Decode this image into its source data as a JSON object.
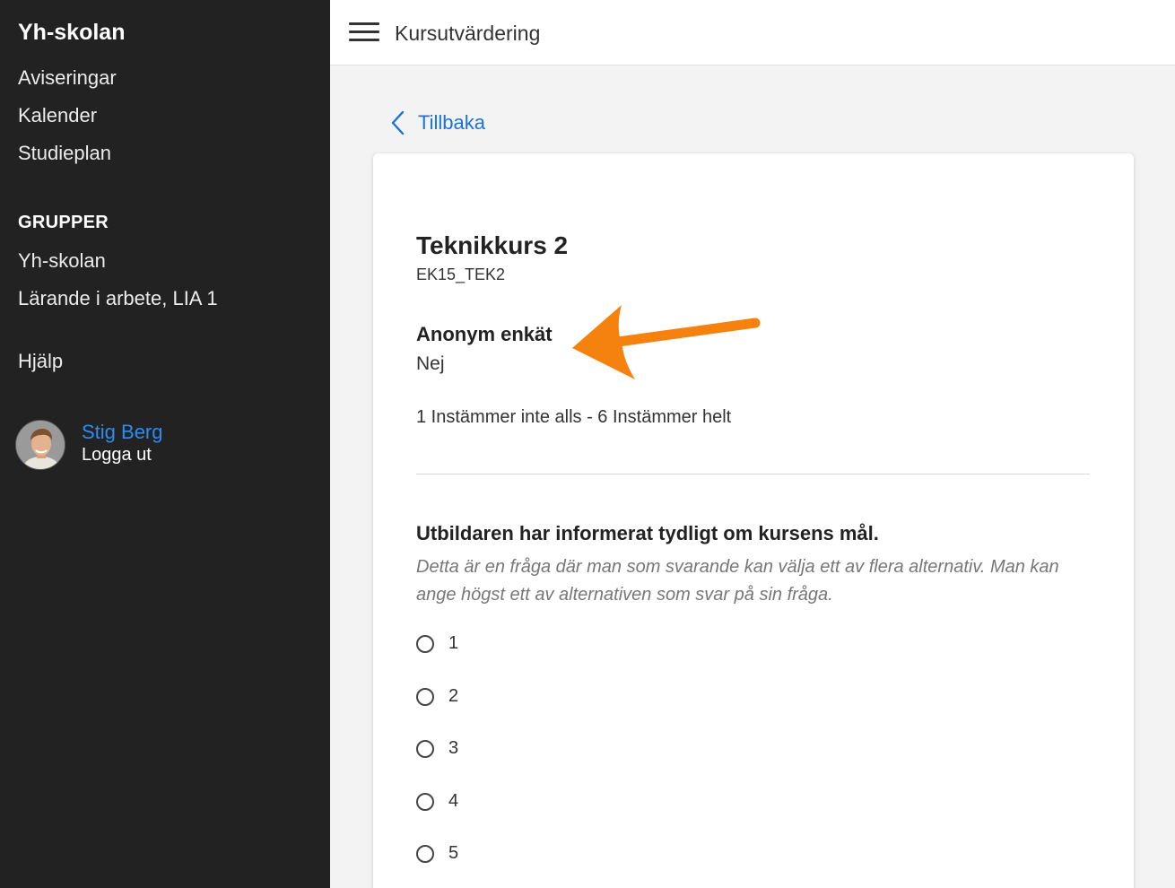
{
  "sidebar": {
    "brand": "Yh-skolan",
    "nav": [
      {
        "label": "Aviseringar"
      },
      {
        "label": "Kalender"
      },
      {
        "label": "Studieplan"
      }
    ],
    "groups_heading": "GRUPPER",
    "groups": [
      {
        "label": "Yh-skolan"
      },
      {
        "label": "Lärande i arbete, LIA 1"
      }
    ],
    "help": "Hjälp",
    "user": {
      "name": "Stig Berg",
      "logout": "Logga ut"
    }
  },
  "header": {
    "title": "Kursutvärdering",
    "menu_icon": "hamburger-menu-icon"
  },
  "main": {
    "back_label": "Tillbaka",
    "back_icon": "chevron-left-icon",
    "course": {
      "title": "Teknikkurs 2",
      "code": "EK15_TEK2"
    },
    "anonymous": {
      "label": "Anonym enkät",
      "value": "Nej"
    },
    "scale": "1 Instämmer inte alls - 6 Instämmer helt",
    "question": {
      "text": "Utbildaren har informerat tydligt om kursens mål.",
      "help": "Detta är en fråga där man som svarande kan välja ett av flera alternativ. Man kan ange högst ett av alternativen som svar på sin fråga.",
      "options": [
        "1",
        "2",
        "3",
        "4",
        "5"
      ]
    }
  },
  "colors": {
    "sidebar_bg": "#222222",
    "link": "#1a73d9",
    "user_link": "#2b8df0",
    "annotation_arrow": "#f5820f"
  }
}
